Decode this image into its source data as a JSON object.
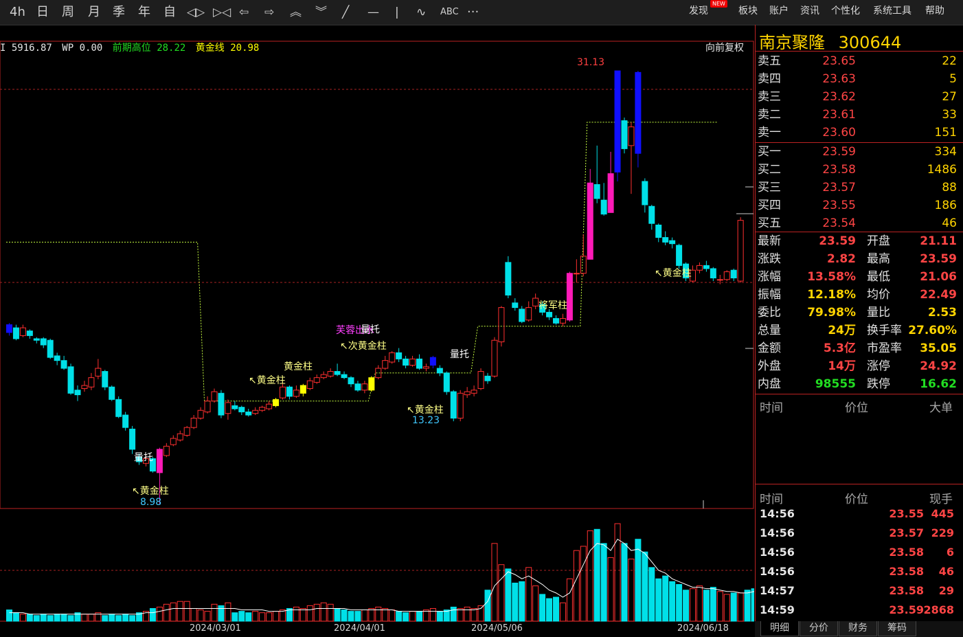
{
  "toolbar": {
    "periods": [
      "4h",
      "日",
      "周",
      "月",
      "季",
      "年",
      "自"
    ],
    "tool_icons": [
      "expand-icon",
      "shrink-icon",
      "arrow-left-icon",
      "arrow-right-icon",
      "chevron-up-icon",
      "chevron-down-icon",
      "diagonal-line-icon",
      "horizontal-line-icon",
      "vertical-line-icon",
      "wave-line-icon"
    ],
    "text_tool": "ABC",
    "more": "···",
    "menus": [
      "发现",
      "板块",
      "账户",
      "资讯",
      "个性化",
      "系统工具",
      "帮助"
    ],
    "new_badge": "NEW"
  },
  "info": {
    "i_label": "I 5916.87",
    "wp_label": "WP 0.00",
    "prev_high_label": "前期高位",
    "prev_high_value": "28.22",
    "golden_line_label": "黄金线",
    "golden_line_value": "20.98",
    "fq": "向前复权"
  },
  "colors": {
    "up": "#ff3030",
    "down": "#00e0e8",
    "magenta": "#ff1ab8",
    "blue": "#1010ff",
    "yellow": "#ffff00"
  },
  "stock": {
    "name": "南京聚隆",
    "code": "300644"
  },
  "orderbook": {
    "asks": [
      {
        "label": "卖五",
        "price": "23.65",
        "vol": "22"
      },
      {
        "label": "卖四",
        "price": "23.63",
        "vol": "5"
      },
      {
        "label": "卖三",
        "price": "23.62",
        "vol": "27"
      },
      {
        "label": "卖二",
        "price": "23.61",
        "vol": "33"
      },
      {
        "label": "卖一",
        "price": "23.60",
        "vol": "151"
      }
    ],
    "bids": [
      {
        "label": "买一",
        "price": "23.59",
        "vol": "334"
      },
      {
        "label": "买二",
        "price": "23.58",
        "vol": "1486"
      },
      {
        "label": "买三",
        "price": "23.57",
        "vol": "88"
      },
      {
        "label": "买四",
        "price": "23.55",
        "vol": "186"
      },
      {
        "label": "买五",
        "price": "23.54",
        "vol": "46"
      }
    ]
  },
  "quote": [
    {
      "l": "最新",
      "v": "23.59",
      "c": "#ff4545",
      "l2": "开盘",
      "v2": "21.11",
      "c2": "#ff4545"
    },
    {
      "l": "涨跌",
      "v": "2.82",
      "c": "#ff4545",
      "l2": "最高",
      "v2": "23.59",
      "c2": "#ff4545"
    },
    {
      "l": "涨幅",
      "v": "13.58%",
      "c": "#ff4545",
      "l2": "最低",
      "v2": "21.06",
      "c2": "#ff4545"
    },
    {
      "l": "振幅",
      "v": "12.18%",
      "c": "#ffd400",
      "l2": "均价",
      "v2": "22.49",
      "c2": "#ff4545"
    },
    {
      "l": "委比",
      "v": "79.98%",
      "c": "#ffd400",
      "l2": "量比",
      "v2": "2.53",
      "c2": "#ffd400"
    },
    {
      "l": "总量",
      "v": "24万",
      "c": "#ffd400",
      "l2": "换手率",
      "v2": "27.60%",
      "c2": "#ffd400"
    },
    {
      "l": "金额",
      "v": "5.3亿",
      "c": "#ff4545",
      "l2": "市盈率",
      "v2": "35.05",
      "c2": "#ffd400"
    },
    {
      "l": "外盘",
      "v": "14万",
      "c": "#ff4545",
      "l2": "涨停",
      "v2": "24.92",
      "c2": "#ff4545"
    },
    {
      "l": "内盘",
      "v": "98555",
      "c": "#22dd22",
      "l2": "跌停",
      "v2": "16.62",
      "c2": "#22dd22"
    }
  ],
  "bigorder_header": {
    "time": "时间",
    "price": "价位",
    "big": "大单"
  },
  "ticks_header": {
    "time": "时间",
    "price": "价位",
    "vol": "现手"
  },
  "ticks": [
    {
      "t": "14:56",
      "p": "23.55",
      "v": "445"
    },
    {
      "t": "14:56",
      "p": "23.57",
      "v": "229"
    },
    {
      "t": "14:56",
      "p": "23.58",
      "v": "6"
    },
    {
      "t": "14:56",
      "p": "23.58",
      "v": "46"
    },
    {
      "t": "14:57",
      "p": "23.58",
      "v": "29"
    },
    {
      "t": "14:59",
      "p": "23.59",
      "v": "2868"
    }
  ],
  "tabs": [
    "明细",
    "分价",
    "财务",
    "筹码"
  ],
  "chart_data": {
    "type": "candlestick",
    "series": [
      {
        "o": 14.8,
        "c": 14.3,
        "h": 14.9,
        "l": 14.1,
        "s": "b"
      },
      {
        "o": 14.6,
        "c": 13.9,
        "h": 14.8,
        "l": 13.8
      },
      {
        "o": 14.1,
        "c": 14.6,
        "h": 14.8,
        "l": 14.0
      },
      {
        "o": 14.4,
        "c": 14.1,
        "h": 14.5,
        "l": 13.9
      },
      {
        "o": 13.9,
        "c": 13.8,
        "h": 14.0,
        "l": 13.6
      },
      {
        "o": 13.9,
        "c": 13.5,
        "h": 14.0,
        "l": 13.3
      },
      {
        "o": 13.8,
        "c": 12.7,
        "h": 13.9,
        "l": 12.6
      },
      {
        "o": 12.8,
        "c": 12.5,
        "h": 13.0,
        "l": 12.2
      },
      {
        "o": 12.5,
        "c": 12.0,
        "h": 12.8,
        "l": 11.9
      },
      {
        "o": 12.1,
        "c": 10.4,
        "h": 12.3,
        "l": 10.3
      },
      {
        "o": 10.6,
        "c": 10.3,
        "h": 10.9,
        "l": 9.9
      },
      {
        "o": 10.7,
        "c": 10.9,
        "h": 11.2,
        "l": 10.5
      },
      {
        "o": 10.8,
        "c": 11.4,
        "h": 11.7,
        "l": 10.6
      },
      {
        "o": 11.5,
        "c": 12.0,
        "h": 12.6,
        "l": 11.3
      },
      {
        "o": 11.8,
        "c": 10.8,
        "h": 11.9,
        "l": 10.6
      },
      {
        "o": 10.8,
        "c": 10.0,
        "h": 10.9,
        "l": 9.9
      },
      {
        "o": 10.0,
        "c": 8.9,
        "h": 10.2,
        "l": 8.8
      },
      {
        "o": 9.0,
        "c": 8.2,
        "h": 9.2,
        "l": 8.0
      },
      {
        "o": 8.1,
        "c": 6.8,
        "h": 8.3,
        "l": 6.5
      },
      {
        "o": 6.3,
        "c": 6.0,
        "h": 6.5,
        "l": 5.8
      },
      {
        "o": 5.9,
        "c": 6.2,
        "h": 6.4,
        "l": 5.7
      },
      {
        "o": 6.2,
        "c": 5.4,
        "h": 6.3,
        "l": 5.3
      },
      {
        "o": 5.3,
        "c": 6.8,
        "h": 6.9,
        "l": 3.3,
        "s": "m"
      },
      {
        "o": 6.4,
        "c": 7.0,
        "h": 7.2,
        "l": 6.3
      },
      {
        "o": 7.1,
        "c": 7.5,
        "h": 7.7,
        "l": 7.0
      },
      {
        "o": 7.4,
        "c": 7.8,
        "h": 8.0,
        "l": 7.3
      },
      {
        "o": 7.7,
        "c": 8.2,
        "h": 8.3,
        "l": 7.6
      },
      {
        "o": 8.2,
        "c": 8.8,
        "h": 9.0,
        "l": 8.1
      },
      {
        "o": 8.8,
        "c": 9.3,
        "h": 9.5,
        "l": 8.7
      },
      {
        "o": 9.2,
        "c": 9.9,
        "h": 10.2,
        "l": 9.1
      },
      {
        "o": 9.9,
        "c": 10.5,
        "h": 10.7,
        "l": 9.8
      },
      {
        "o": 10.4,
        "c": 9.0,
        "h": 10.6,
        "l": 8.8
      },
      {
        "o": 9.1,
        "c": 9.8,
        "h": 10.0,
        "l": 8.7
      },
      {
        "o": 9.6,
        "c": 9.4,
        "h": 9.9,
        "l": 9.3
      },
      {
        "o": 9.5,
        "c": 9.2,
        "h": 9.6,
        "l": 9.0
      },
      {
        "o": 9.2,
        "c": 9.0,
        "h": 9.4,
        "l": 8.9
      },
      {
        "o": 9.1,
        "c": 9.3,
        "h": 9.5,
        "l": 9.0
      },
      {
        "o": 9.3,
        "c": 9.5,
        "h": 9.6,
        "l": 9.2
      },
      {
        "o": 9.4,
        "c": 9.7,
        "h": 9.9,
        "l": 9.3
      },
      {
        "o": 9.6,
        "c": 10.0,
        "h": 10.1,
        "l": 9.5,
        "s": "y"
      },
      {
        "o": 10.1,
        "c": 10.8,
        "h": 11.0,
        "l": 10.0
      },
      {
        "o": 10.8,
        "c": 10.2,
        "h": 10.9,
        "l": 10.0
      },
      {
        "o": 10.2,
        "c": 10.6,
        "h": 10.9,
        "l": 10.1
      },
      {
        "o": 10.4,
        "c": 10.9,
        "h": 11.0,
        "l": 10.2,
        "s": "y"
      },
      {
        "o": 10.7,
        "c": 11.2,
        "h": 11.4,
        "l": 10.6
      },
      {
        "o": 11.1,
        "c": 11.4,
        "h": 11.6,
        "l": 11.0
      },
      {
        "o": 11.4,
        "c": 11.6,
        "h": 11.8,
        "l": 11.3
      },
      {
        "o": 11.5,
        "c": 11.8,
        "h": 12.0,
        "l": 11.4
      },
      {
        "o": 11.8,
        "c": 11.6,
        "h": 12.3,
        "l": 11.5
      },
      {
        "o": 11.6,
        "c": 11.4,
        "h": 11.8,
        "l": 11.3
      },
      {
        "o": 11.4,
        "c": 11.0,
        "h": 11.5,
        "l": 10.8
      },
      {
        "o": 11.0,
        "c": 10.6,
        "h": 11.2,
        "l": 10.5
      },
      {
        "o": 10.6,
        "c": 11.0,
        "h": 11.2,
        "l": 10.4
      },
      {
        "o": 10.6,
        "c": 11.4,
        "h": 11.5,
        "l": 10.5,
        "s": "y"
      },
      {
        "o": 11.4,
        "c": 12.0,
        "h": 12.2,
        "l": 11.3
      },
      {
        "o": 12.0,
        "c": 12.5,
        "h": 12.8,
        "l": 11.9
      },
      {
        "o": 12.4,
        "c": 13.0,
        "h": 13.1,
        "l": 12.3
      },
      {
        "o": 13.0,
        "c": 12.6,
        "h": 13.3,
        "l": 12.4
      },
      {
        "o": 12.6,
        "c": 12.2,
        "h": 12.8,
        "l": 12.0
      },
      {
        "o": 12.2,
        "c": 12.6,
        "h": 12.8,
        "l": 12.1
      },
      {
        "o": 12.6,
        "c": 12.0,
        "h": 12.9,
        "l": 11.9
      },
      {
        "o": 12.0,
        "c": 12.1,
        "h": 12.3,
        "l": 11.8
      },
      {
        "o": 12.2,
        "c": 12.7,
        "h": 12.8,
        "l": 12.0,
        "s": "b"
      },
      {
        "o": 12.0,
        "c": 11.7,
        "h": 12.2,
        "l": 11.5
      },
      {
        "o": 11.7,
        "c": 10.5,
        "h": 11.8,
        "l": 10.3
      },
      {
        "o": 10.5,
        "c": 8.8,
        "h": 10.6,
        "l": 8.6
      },
      {
        "o": 8.8,
        "c": 10.4,
        "h": 10.6,
        "l": 8.6
      },
      {
        "o": 10.3,
        "c": 10.5,
        "h": 10.8,
        "l": 10.1
      },
      {
        "o": 10.4,
        "c": 10.6,
        "h": 10.9,
        "l": 10.2
      },
      {
        "o": 10.7,
        "c": 11.8,
        "h": 12.0,
        "l": 10.6
      },
      {
        "o": 11.5,
        "c": 11.2,
        "h": 11.7,
        "l": 11.0
      },
      {
        "o": 11.5,
        "c": 13.8,
        "h": 14.0,
        "l": 11.4
      },
      {
        "o": 13.7,
        "c": 15.9,
        "h": 16.0,
        "l": 13.4
      },
      {
        "o": 18.8,
        "c": 16.7,
        "h": 19.2,
        "l": 16.5
      },
      {
        "o": 16.2,
        "c": 15.9,
        "h": 16.5,
        "l": 15.7
      },
      {
        "o": 15.8,
        "c": 15.0,
        "h": 16.0,
        "l": 14.9
      },
      {
        "o": 15.1,
        "c": 15.9,
        "h": 16.3,
        "l": 15.0
      },
      {
        "o": 16.0,
        "c": 16.5,
        "h": 16.8,
        "l": 15.8
      },
      {
        "o": 16.1,
        "c": 15.6,
        "h": 16.3,
        "l": 15.4
      },
      {
        "o": 15.6,
        "c": 15.3,
        "h": 15.8,
        "l": 15.1
      },
      {
        "o": 15.2,
        "c": 14.9,
        "h": 15.4,
        "l": 14.8
      },
      {
        "o": 14.9,
        "c": 15.2,
        "h": 15.5,
        "l": 14.7
      },
      {
        "o": 15.1,
        "c": 18.1,
        "h": 18.2,
        "l": 15.0,
        "s": "m"
      },
      {
        "o": 18.1,
        "c": 18.1,
        "h": 19.0,
        "l": 17.5
      },
      {
        "o": 18.1,
        "c": 19.2,
        "h": 20.6,
        "l": 17.9
      },
      {
        "o": 19.0,
        "c": 23.9,
        "h": 24.8,
        "l": 19.0,
        "s": "m"
      },
      {
        "o": 23.8,
        "c": 22.9,
        "h": 26.3,
        "l": 22.6
      },
      {
        "o": 22.8,
        "c": 21.9,
        "h": 23.9,
        "l": 21.8
      },
      {
        "o": 22.0,
        "c": 24.5,
        "h": 25.9,
        "l": 22.0,
        "s": "m"
      },
      {
        "o": 24.6,
        "c": 31.1,
        "h": 31.1,
        "l": 24.0,
        "s": "b"
      },
      {
        "o": 27.9,
        "c": 26.1,
        "h": 28.1,
        "l": 25.8
      },
      {
        "o": 26.3,
        "c": 27.5,
        "h": 27.8,
        "l": 23.2
      },
      {
        "o": 31.0,
        "c": 25.8,
        "h": 31.1,
        "l": 24.9,
        "s": "b"
      },
      {
        "o": 24.0,
        "c": 22.5,
        "h": 24.2,
        "l": 22.0
      },
      {
        "o": 22.4,
        "c": 21.3,
        "h": 22.5,
        "l": 20.9
      },
      {
        "o": 21.2,
        "c": 20.4,
        "h": 21.3,
        "l": 20.1
      },
      {
        "o": 20.4,
        "c": 20.1,
        "h": 20.8,
        "l": 19.9
      },
      {
        "o": 20.2,
        "c": 20.0,
        "h": 20.4,
        "l": 19.7
      },
      {
        "o": 19.9,
        "c": 18.6,
        "h": 20.0,
        "l": 18.4
      },
      {
        "o": 18.7,
        "c": 17.8,
        "h": 18.8,
        "l": 17.6
      },
      {
        "o": 17.6,
        "c": 18.3,
        "h": 18.6,
        "l": 17.5
      },
      {
        "o": 18.3,
        "c": 18.6,
        "h": 18.8,
        "l": 18.1
      },
      {
        "o": 18.6,
        "c": 18.4,
        "h": 18.9,
        "l": 18.2
      },
      {
        "o": 18.4,
        "c": 17.8,
        "h": 18.5,
        "l": 17.6
      },
      {
        "o": 17.7,
        "c": 17.7,
        "h": 18.0,
        "l": 17.4
      },
      {
        "o": 17.7,
        "c": 18.2,
        "h": 18.3,
        "l": 17.6
      },
      {
        "o": 18.3,
        "c": 17.8,
        "h": 18.4,
        "l": 17.6
      },
      {
        "o": 17.6,
        "c": 21.5,
        "h": 21.7,
        "l": 17.5
      }
    ],
    "volume": [
      8,
      6,
      5,
      5,
      4,
      5,
      4,
      5,
      5,
      4,
      6,
      5,
      5,
      6,
      4,
      5,
      4,
      5,
      4,
      6,
      7,
      9,
      10,
      12,
      13,
      14,
      14,
      9,
      8,
      7,
      12,
      11,
      13,
      6,
      7,
      6,
      7,
      6,
      6,
      7,
      8,
      9,
      10,
      9,
      11,
      12,
      13,
      12,
      9,
      8,
      7,
      7,
      8,
      9,
      10,
      9,
      8,
      7,
      6,
      7,
      7,
      8,
      9,
      7,
      8,
      10,
      9,
      10,
      9,
      11,
      22,
      55,
      40,
      37,
      27,
      28,
      38,
      25,
      19,
      16,
      17,
      13,
      30,
      50,
      53,
      64,
      65,
      55,
      45,
      69,
      55,
      44,
      58,
      49,
      38,
      30,
      32,
      28,
      26,
      22,
      23,
      25,
      22,
      24,
      21,
      19,
      20,
      20,
      22,
      23,
      38
    ],
    "ma_volume": [
      6,
      6,
      6,
      5,
      5,
      5,
      5,
      5,
      5,
      5,
      5,
      5,
      5,
      5,
      5,
      5,
      5,
      5,
      5,
      5,
      6,
      6,
      7,
      8,
      9,
      9,
      9,
      9,
      9,
      9,
      9,
      9,
      9,
      9,
      8,
      8,
      8,
      8,
      7,
      7,
      7,
      8,
      8,
      8,
      8,
      9,
      9,
      9,
      9,
      9,
      8,
      8,
      8,
      8,
      8,
      8,
      8,
      7,
      7,
      7,
      7,
      7,
      7,
      7,
      7,
      8,
      8,
      8,
      8,
      9,
      14,
      25,
      30,
      35,
      33,
      30,
      32,
      29,
      26,
      22,
      20,
      17,
      20,
      30,
      40,
      50,
      55,
      54,
      50,
      58,
      55,
      50,
      51,
      48,
      42,
      36,
      34,
      30,
      28,
      26,
      24,
      24,
      23,
      23,
      22,
      21,
      21,
      20,
      20,
      21,
      26
    ],
    "annotations": [
      {
        "text": "量托",
        "x": 195,
        "y": 670,
        "c": "#ffffff"
      },
      {
        "text": "↖黄金柱",
        "x": 192,
        "y": 719,
        "c": "#ffff88"
      },
      {
        "text": "8.98",
        "x": 204,
        "y": 735,
        "c": "#40c8ff"
      },
      {
        "text": "↖黄金柱",
        "x": 362,
        "y": 558,
        "c": "#ffff88"
      },
      {
        "text": "黄金柱",
        "x": 413,
        "y": 538,
        "c": "#ffff88"
      },
      {
        "text": "芙蓉出水",
        "x": 489,
        "y": 485,
        "c": "#ff40ff"
      },
      {
        "text": "量托",
        "x": 525,
        "y": 484,
        "c": "#ffffff"
      },
      {
        "text": "↖次黄金柱",
        "x": 495,
        "y": 508,
        "c": "#ffff88"
      },
      {
        "text": "↖黄金柱",
        "x": 592,
        "y": 601,
        "c": "#ffff88"
      },
      {
        "text": "13.23",
        "x": 600,
        "y": 616,
        "c": "#40c8ff"
      },
      {
        "text": "量托",
        "x": 655,
        "y": 520,
        "c": "#ffffff"
      },
      {
        "text": "将军柱",
        "x": 784,
        "y": 449,
        "c": "#ffff88"
      },
      {
        "text": "31.13",
        "x": 840,
        "y": 95,
        "c": "#ff4040"
      },
      {
        "text": "↖黄金柱",
        "x": 953,
        "y": 402,
        "c": "#ffff88"
      }
    ],
    "x_labels": [
      "2024/03/01",
      "2024/04/01",
      "2024/05/06",
      "2024/06/18"
    ],
    "golden_line": 20.98,
    "prev_high": 28.22
  }
}
